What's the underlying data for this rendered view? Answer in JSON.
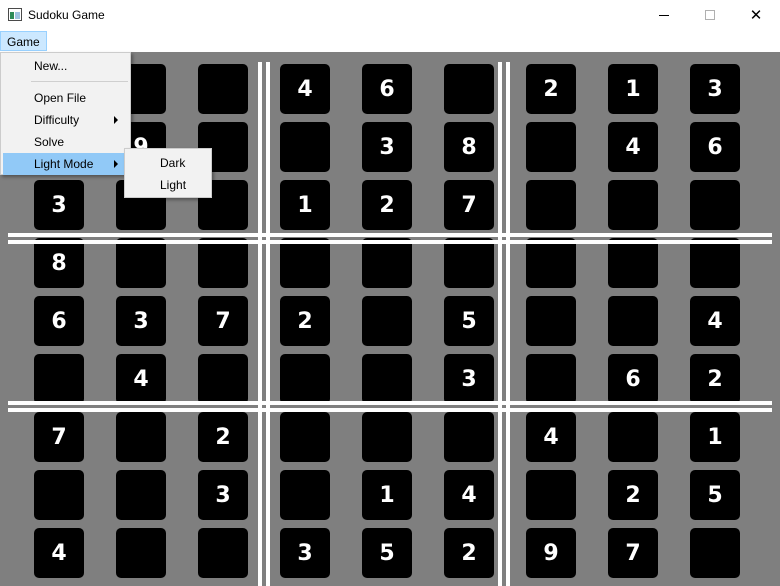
{
  "window": {
    "title": "Sudoku Game",
    "minimize_icon": "minimize-icon",
    "maximize_icon": "maximize-icon",
    "close_icon": "close-icon",
    "close_glyph": "✕"
  },
  "menubar": {
    "game_label": "Game"
  },
  "game_menu": {
    "items": [
      {
        "label": "New..."
      },
      {
        "label": "Open File"
      },
      {
        "label": "Difficulty",
        "has_submenu": true
      },
      {
        "label": "Solve"
      },
      {
        "label": "Light Mode",
        "has_submenu": true,
        "highlighted": true
      }
    ]
  },
  "theme_submenu": {
    "items": [
      {
        "label": "Dark"
      },
      {
        "label": "Light"
      }
    ]
  },
  "board": {
    "colors": {
      "background": "#7f7f7f",
      "cell": "#000000",
      "digit": "#ffffff",
      "divider": "#ffffff"
    },
    "rows": [
      [
        "",
        "",
        "",
        "4",
        "6",
        "",
        "2",
        "1",
        "3"
      ],
      [
        "",
        "9",
        "",
        "",
        "3",
        "8",
        "",
        "4",
        "6"
      ],
      [
        "3",
        "",
        "",
        "1",
        "2",
        "7",
        "",
        "",
        ""
      ],
      [
        "8",
        "",
        "",
        "",
        "",
        "",
        "",
        "",
        ""
      ],
      [
        "6",
        "3",
        "7",
        "2",
        "",
        "5",
        "",
        "",
        "4"
      ],
      [
        "",
        "4",
        "",
        "",
        "",
        "3",
        "",
        "6",
        "2"
      ],
      [
        "7",
        "",
        "2",
        "",
        "",
        "",
        "4",
        "",
        "1"
      ],
      [
        "",
        "",
        "3",
        "",
        "1",
        "4",
        "",
        "2",
        "5"
      ],
      [
        "4",
        "",
        "",
        "3",
        "5",
        "2",
        "9",
        "7",
        ""
      ]
    ]
  }
}
